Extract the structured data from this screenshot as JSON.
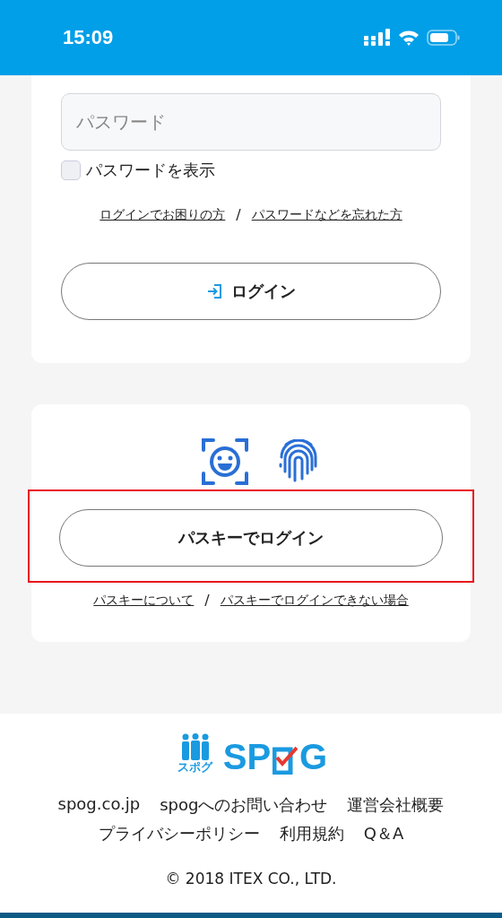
{
  "status_bar": {
    "time": "15:09"
  },
  "login_card": {
    "password_field": {
      "placeholder": "パスワード"
    },
    "show_password": {
      "label": "パスワードを表示",
      "checked": false
    },
    "links": [
      "ログインでお困りの方",
      "パスワードなどを忘れた方"
    ],
    "separator": "/",
    "login_button": "ログイン"
  },
  "passkey_card": {
    "passkey_button": {
      "label": "パスキーでログイン",
      "highlighted": true
    },
    "links": [
      "パスキーについて",
      "パスキーでログインできない場合"
    ],
    "separator": "/"
  },
  "footer": {
    "logo": {
      "left": "SP",
      "right": "G",
      "kana": "スポグ"
    },
    "links": [
      [
        "spog.co.jp",
        "spogへのお問い合わせ",
        "運営会社概要"
      ],
      [
        "プライバシーポリシー",
        "利用規約",
        "Q＆A"
      ]
    ],
    "copyright": "© 2018 ITEX CO., LTD."
  }
}
